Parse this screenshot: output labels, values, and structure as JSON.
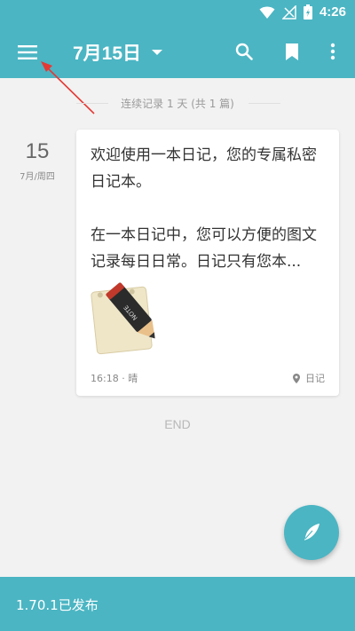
{
  "status_bar": {
    "time": "4:26",
    "icons": [
      "wifi-icon",
      "signal-muted-icon",
      "battery-icon"
    ]
  },
  "toolbar": {
    "title": "7月15日",
    "icons": [
      "menu-icon",
      "search-icon",
      "bookmark-icon",
      "more-icon"
    ]
  },
  "timeline": {
    "streak": "连续记录 1 天 (共 1 篇)",
    "end": "END"
  },
  "entry": {
    "day": "15",
    "sub": "7月/周四",
    "paragraph1": "欢迎使用一本日记，您的专属私密日记本。",
    "paragraph2": "在一本日记中，您可以方便的图文记录每日日常。日记只有您本...",
    "time_weather": "16:18 · 晴",
    "location": "日记",
    "image_label": "NOTE"
  },
  "banner": {
    "text": "1.70.1已发布"
  },
  "colors": {
    "primary": "#4bb5c3",
    "annotation_arrow": "#e53935"
  }
}
